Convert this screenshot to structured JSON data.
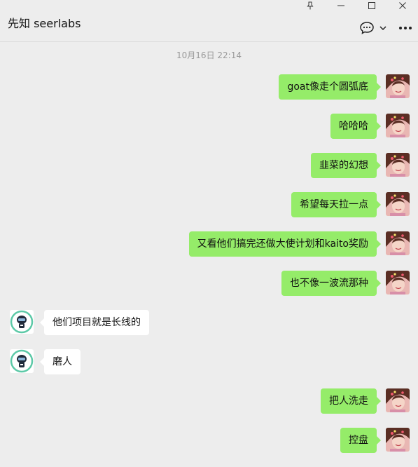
{
  "window": {
    "controls": [
      {
        "name": "pin-icon"
      },
      {
        "name": "minimize-icon"
      },
      {
        "name": "maximize-icon"
      },
      {
        "name": "close-icon"
      }
    ]
  },
  "chat": {
    "title": "先知 seerlabs",
    "header_icons": [
      "chat-bubble-icon",
      "chevron-down-icon",
      "more-icon"
    ]
  },
  "timestamp": "10月16日 22:14",
  "colors": {
    "background": "#ededed",
    "outgoing_bubble": "#95ec69",
    "incoming_bubble": "#ffffff"
  },
  "messages": [
    {
      "dir": "out",
      "text": "goat像走个圆弧底"
    },
    {
      "dir": "out",
      "text": "哈哈哈"
    },
    {
      "dir": "out",
      "text": "韭菜的幻想"
    },
    {
      "dir": "out",
      "text": "希望每天拉一点"
    },
    {
      "dir": "out",
      "text": "又看他们搞完还做大使计划和kaito奖励"
    },
    {
      "dir": "out",
      "text": "也不像一波流那种"
    },
    {
      "dir": "in",
      "text": "他们项目就是长线的"
    },
    {
      "dir": "in",
      "text": "磨人"
    },
    {
      "dir": "out",
      "text": "把人洗走"
    },
    {
      "dir": "out",
      "text": "控盘"
    }
  ]
}
